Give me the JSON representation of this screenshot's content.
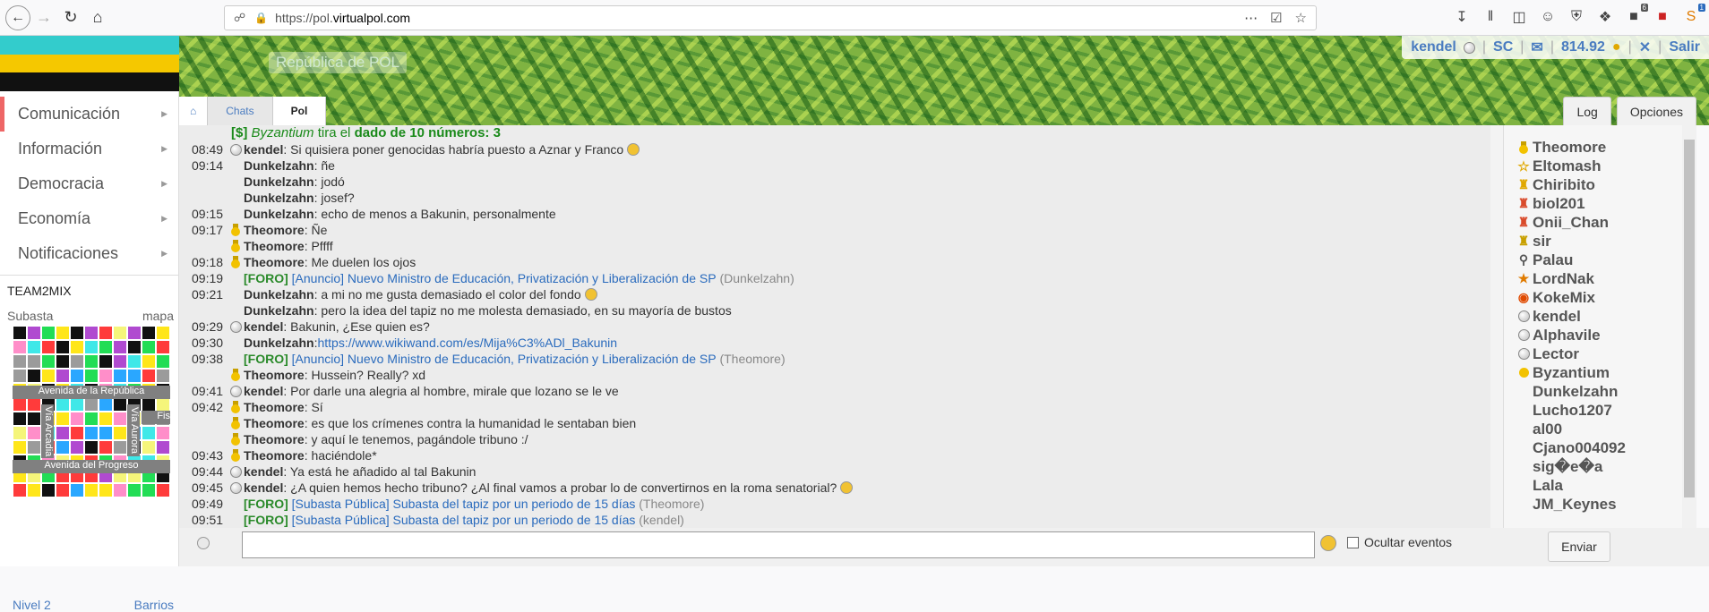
{
  "browser": {
    "url_prefix": "https://pol.",
    "url_host": "virtualpol.com",
    "ext_badges": [
      "6",
      "1"
    ]
  },
  "header": {
    "site_name": "República de POL",
    "user": "kendel",
    "sc": "SC",
    "balance": "814.92",
    "logout": "Salir",
    "crumbs": [
      "Chats",
      "Pol"
    ],
    "tabs": [
      "Log",
      "Opciones"
    ]
  },
  "sidebar": {
    "items": [
      "Comunicación",
      "Información",
      "Democracia",
      "Economía",
      "Notificaciones"
    ],
    "team": "TEAM2MIX",
    "map_left": "Subasta",
    "map_right": "mapa",
    "map_labels": [
      "Avenida de la República",
      "Vía Arcadia",
      "Vía Aurora",
      "Fis",
      "Avenida del Progreso"
    ],
    "foot_left": "Nivel 2",
    "foot_right": "Barrios"
  },
  "chat": {
    "dice": {
      "prefix": "[$]",
      "user": "Byzantium",
      "mid": " tira el ",
      "bold": "dado de 10 números: 3"
    },
    "messages": [
      {
        "time": "08:49",
        "icon": "gray",
        "nick": "kendel",
        "text": ": Si quisiera poner genocidas habría puesto a Aznar y Franco",
        "emoji": true
      },
      {
        "time": "09:14",
        "icon": "",
        "nick": "Dunkelzahn",
        "text": ": ñe"
      },
      {
        "time": "",
        "icon": "",
        "nick": "Dunkelzahn",
        "text": ": jodó"
      },
      {
        "time": "",
        "icon": "",
        "nick": "Dunkelzahn",
        "text": ": josef?"
      },
      {
        "time": "09:15",
        "icon": "",
        "nick": "Dunkelzahn",
        "text": ": echo de menos a Bakunin, personalmente"
      },
      {
        "time": "09:17",
        "icon": "medal",
        "nick": "Theomore",
        "text": ": Ñe"
      },
      {
        "time": "",
        "icon": "medal",
        "nick": "Theomore",
        "text": ": Pffff"
      },
      {
        "time": "09:18",
        "icon": "medal",
        "nick": "Theomore",
        "text": ": Me duelen los ojos"
      },
      {
        "time": "09:19",
        "type": "foro",
        "foro": "[FORO]",
        "link": "[Anuncio] Nuevo Ministro de Educación, Privatización y Liberalización de SP",
        "by": "(Dunkelzahn)"
      },
      {
        "time": "09:21",
        "icon": "",
        "nick": "Dunkelzahn",
        "text": ": a mi no me gusta demasiado el color del fondo",
        "emoji": true
      },
      {
        "time": "",
        "icon": "",
        "nick": "Dunkelzahn",
        "text": ": pero la idea del tapiz no me molesta demasiado, en su mayoría de bustos"
      },
      {
        "time": "09:29",
        "icon": "gray",
        "nick": "kendel",
        "text": ": Bakunin, ¿Ese quien es?"
      },
      {
        "time": "09:30",
        "icon": "",
        "nick": "Dunkelzahn",
        "text": ": ",
        "url": "https://www.wikiwand.com/es/Mija%C3%ADl_Bakunin"
      },
      {
        "time": "09:38",
        "type": "foro",
        "foro": "[FORO]",
        "link": "[Anuncio] Nuevo Ministro de Educación, Privatización y Liberalización de SP",
        "by": "(Theomore)"
      },
      {
        "time": "",
        "icon": "medal",
        "nick": "Theomore",
        "text": ": Hussein? Really? xd"
      },
      {
        "time": "09:41",
        "icon": "gray",
        "nick": "kendel",
        "text": ": Por darle una alegria al hombre, mirale que lozano se le ve"
      },
      {
        "time": "09:42",
        "icon": "medal",
        "nick": "Theomore",
        "text": ": Sí"
      },
      {
        "time": "",
        "icon": "medal",
        "nick": "Theomore",
        "text": ": es que los crímenes contra la humanidad le sentaban bien"
      },
      {
        "time": "",
        "icon": "medal",
        "nick": "Theomore",
        "text": ": y aquí le tenemos, pagándole tribuno :/"
      },
      {
        "time": "09:43",
        "icon": "medal",
        "nick": "Theomore",
        "text": ": haciéndole*"
      },
      {
        "time": "09:44",
        "icon": "gray",
        "nick": "kendel",
        "text": ": Ya está he añadido al tal Bakunin"
      },
      {
        "time": "09:45",
        "icon": "gray",
        "nick": "kendel",
        "text": ": ¿A quien hemos hecho tribuno? ¿Al final vamos a probar lo de convertirnos en la roma senatorial?",
        "emoji": true
      },
      {
        "time": "09:49",
        "type": "foro",
        "foro": "[FORO]",
        "link": "[Subasta Pública] Subasta del tapiz por un periodo de 15 días",
        "by": "(Theomore)"
      },
      {
        "time": "09:51",
        "type": "foro",
        "foro": "[FORO]",
        "link": "[Subasta Pública] Subasta del tapiz por un periodo de 15 días",
        "by": "(kendel)"
      }
    ]
  },
  "users": [
    {
      "name": "Theomore",
      "icon": "medal"
    },
    {
      "name": "Eltomash",
      "icon": "star"
    },
    {
      "name": "Chiribito",
      "icon": "person-gold"
    },
    {
      "name": "biol201",
      "icon": "person-red"
    },
    {
      "name": "Onii_Chan",
      "icon": "person-red"
    },
    {
      "name": "sir",
      "icon": "person-blue"
    },
    {
      "name": "Palau",
      "icon": "magnifier"
    },
    {
      "name": "LordNak",
      "icon": "trophy"
    },
    {
      "name": "KokeMix",
      "icon": "badge-red"
    },
    {
      "name": "kendel",
      "icon": "gray"
    },
    {
      "name": "Alphavile",
      "icon": "gray"
    },
    {
      "name": "Lector",
      "icon": "gray"
    },
    {
      "name": "Byzantium",
      "icon": "yellow-dot"
    },
    {
      "name": "Dunkelzahn",
      "icon": ""
    },
    {
      "name": "Lucho1207",
      "icon": ""
    },
    {
      "name": "al00",
      "icon": ""
    },
    {
      "name": "Cjano004092",
      "icon": ""
    },
    {
      "name": "sig�e�a",
      "icon": ""
    },
    {
      "name": "Lala",
      "icon": ""
    },
    {
      "name": "JM_Keynes",
      "icon": ""
    }
  ],
  "bottom": {
    "hide_events": "Ocultar eventos",
    "send": "Enviar"
  },
  "colors": {
    "flag": [
      "#33cccc",
      "#f5c800",
      "#111111"
    ],
    "link": "#2a6bbd",
    "foro": "#2a8a2a"
  }
}
